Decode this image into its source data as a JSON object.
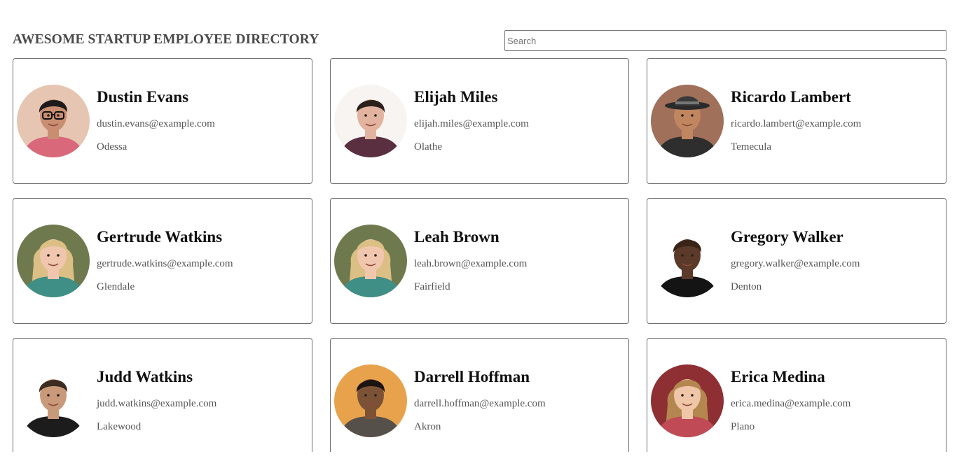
{
  "header": {
    "title": "AWESOME STARTUP EMPLOYEE DIRECTORY",
    "search_placeholder": "Search",
    "search_value": ""
  },
  "employees": [
    {
      "name": "Dustin Evans",
      "email": "dustin.evans@example.com",
      "city": "Odessa",
      "avatar": {
        "bg": "#e6c6b2",
        "skin": "#c98e72",
        "hair": "#1e1a1a",
        "shirt": "#d9697a",
        "glasses": true
      }
    },
    {
      "name": "Elijah Miles",
      "email": "elijah.miles@example.com",
      "city": "Olathe",
      "avatar": {
        "bg": "#f7f4f2",
        "skin": "#e2b39e",
        "hair": "#2c201a",
        "shirt": "#5a3040",
        "glasses": false
      }
    },
    {
      "name": "Ricardo Lambert",
      "email": "ricardo.lambert@example.com",
      "city": "Temecula",
      "avatar": {
        "bg": "#a0705a",
        "skin": "#bf865f",
        "hair": "#2a2a2a",
        "shirt": "#2e2e2e",
        "hat": true
      }
    },
    {
      "name": "Gertrude Watkins",
      "email": "gertrude.watkins@example.com",
      "city": "Glendale",
      "avatar": {
        "bg": "#6e7a4e",
        "skin": "#f0c7ae",
        "hair": "#dcbf84",
        "shirt": "#3f8f86",
        "long_hair": true
      }
    },
    {
      "name": "Leah Brown",
      "email": "leah.brown@example.com",
      "city": "Fairfield",
      "avatar": {
        "bg": "#6e7a4e",
        "skin": "#f0c7ae",
        "hair": "#dcbf84",
        "shirt": "#3f8f86",
        "long_hair": true
      }
    },
    {
      "name": "Gregory Walker",
      "email": "gregory.walker@example.com",
      "city": "Denton",
      "avatar": {
        "bg": "#ffffff",
        "skin": "#5b3a2a",
        "hair": "#3a2418",
        "shirt": "#141414"
      }
    },
    {
      "name": "Judd Watkins",
      "email": "judd.watkins@example.com",
      "city": "Lakewood",
      "avatar": {
        "bg": "#ffffff",
        "skin": "#c99a7a",
        "hair": "#3c2c22",
        "shirt": "#1c1c1c"
      }
    },
    {
      "name": "Darrell Hoffman",
      "email": "darrell.hoffman@example.com",
      "city": "Akron",
      "avatar": {
        "bg": "#e9a24c",
        "skin": "#7c5236",
        "hair": "#1c1410",
        "shirt": "#55504a"
      }
    },
    {
      "name": "Erica Medina",
      "email": "erica.medina@example.com",
      "city": "Plano",
      "avatar": {
        "bg": "#8e2f33",
        "skin": "#efc6a8",
        "hair": "#b3874f",
        "shirt": "#c04a55",
        "long_hair": true
      }
    }
  ]
}
